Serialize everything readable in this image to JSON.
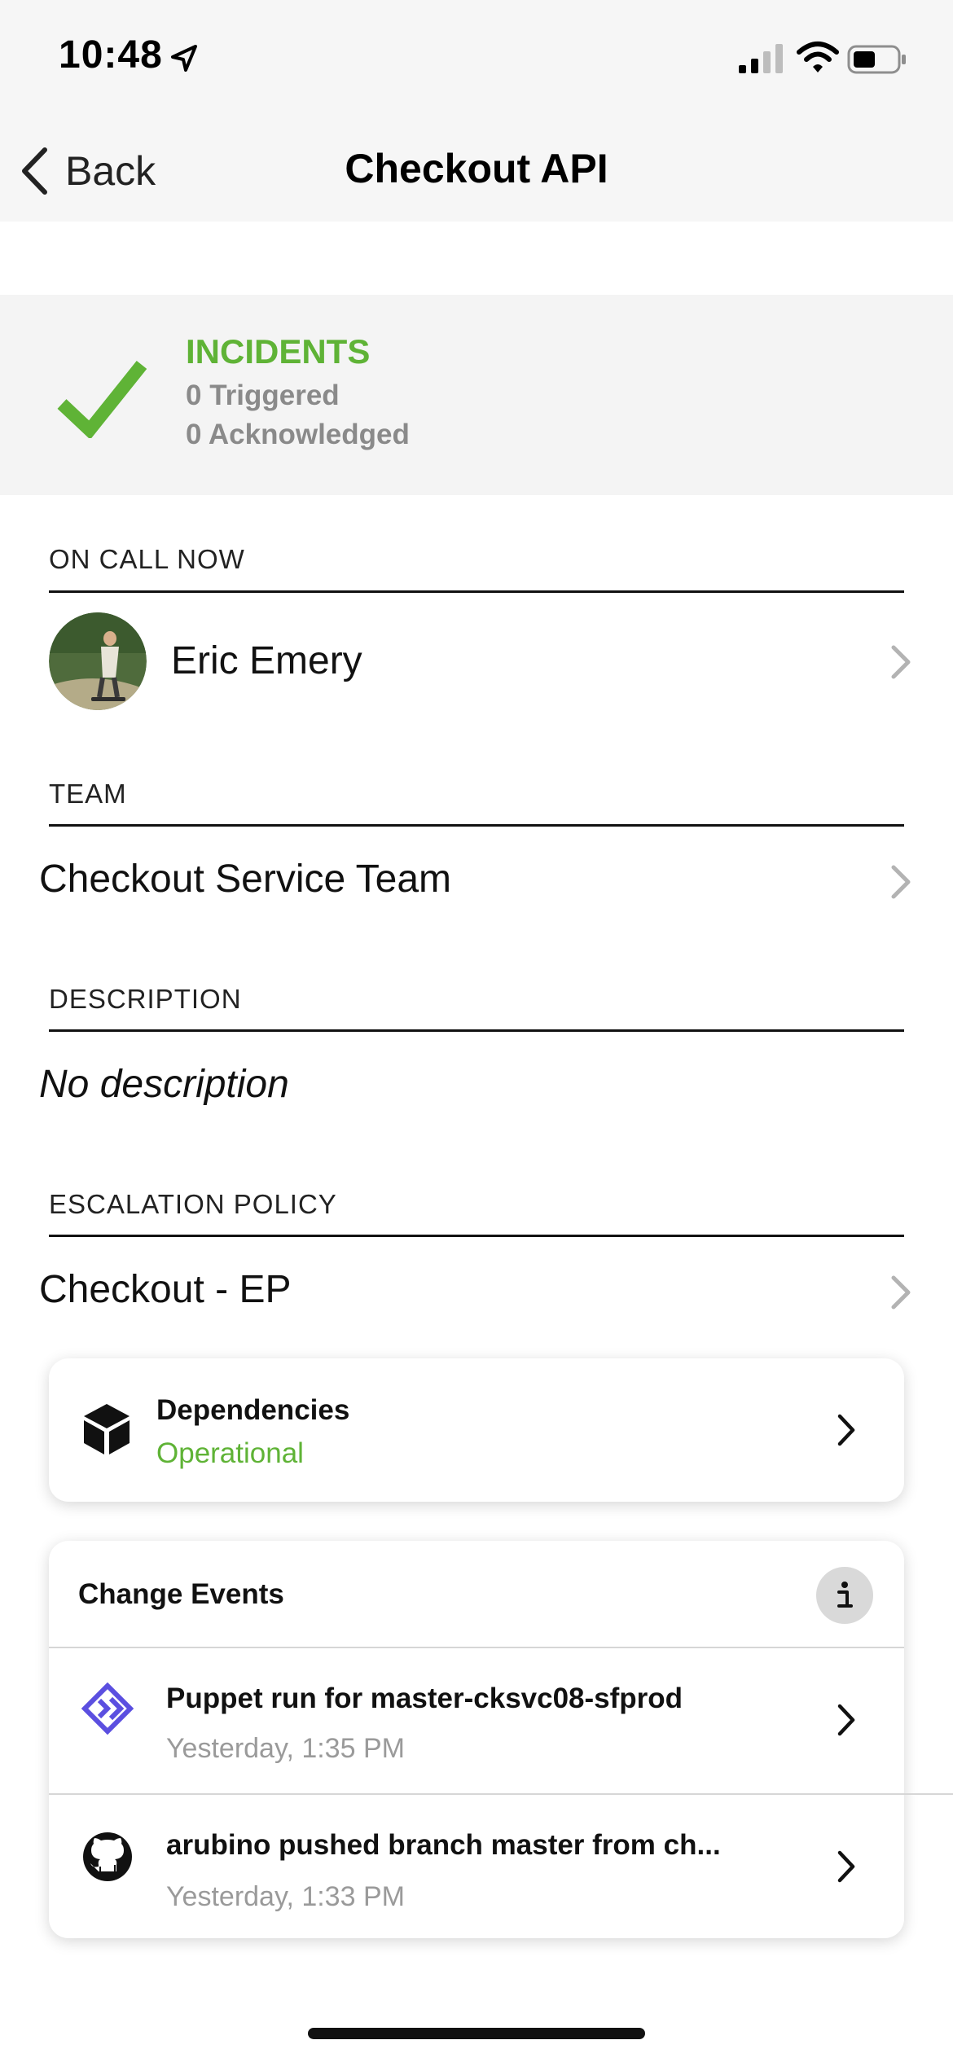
{
  "status_bar": {
    "time": "10:48"
  },
  "nav": {
    "back_label": "Back",
    "title": "Checkout API"
  },
  "incidents": {
    "title": "INCIDENTS",
    "triggered": "0 Triggered",
    "acknowledged": "0 Acknowledged"
  },
  "on_call": {
    "label": "ON CALL NOW",
    "name": "Eric Emery"
  },
  "team": {
    "label": "TEAM",
    "value": "Checkout Service Team"
  },
  "description": {
    "label": "DESCRIPTION",
    "value": "No description"
  },
  "escalation": {
    "label": "ESCALATION POLICY",
    "value": "Checkout - EP"
  },
  "dependencies": {
    "title": "Dependencies",
    "status": "Operational"
  },
  "change_events": {
    "title": "Change Events",
    "items": [
      {
        "title": "Puppet run for master-cksvc08-sfprod",
        "time": "Yesterday, 1:35 PM",
        "icon": "puppet-icon"
      },
      {
        "title": "arubino pushed branch master from ch...",
        "time": "Yesterday, 1:33 PM",
        "icon": "github-icon"
      }
    ]
  },
  "colors": {
    "success": "#5fb336",
    "muted": "#8a8a8a",
    "puppet": "#5b4fe0"
  }
}
